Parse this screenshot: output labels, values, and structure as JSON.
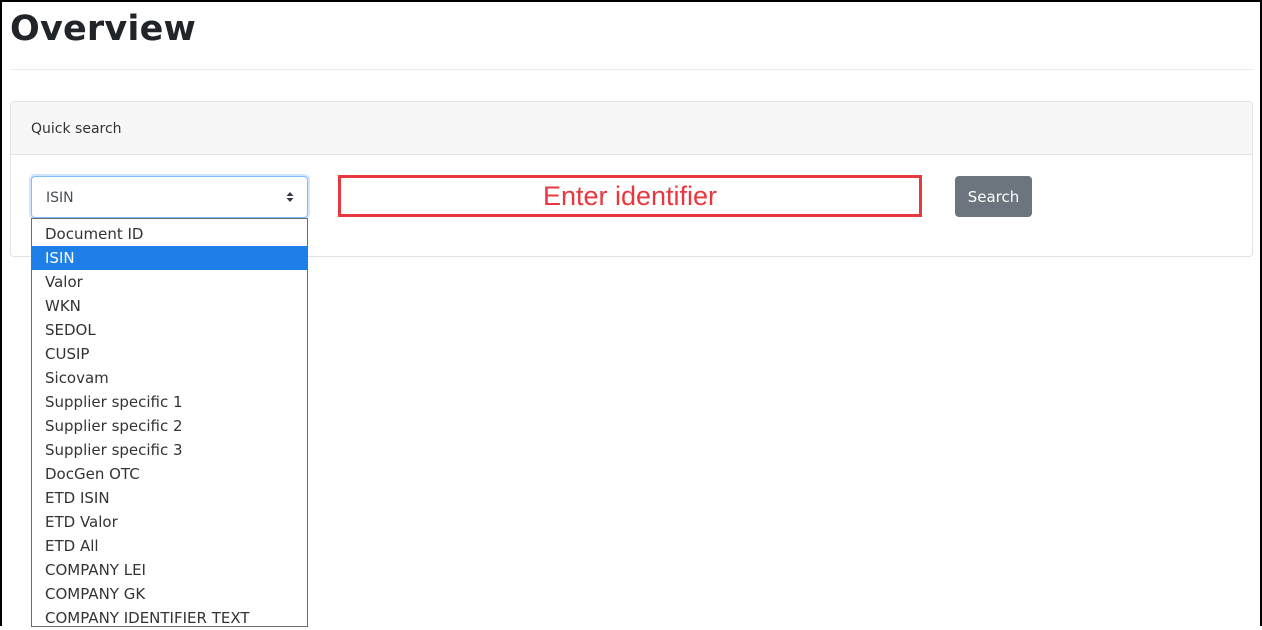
{
  "page": {
    "title": "Overview"
  },
  "quick_search": {
    "header": "Quick search",
    "select": {
      "selected": "ISIN",
      "options": [
        "Document ID",
        "ISIN",
        "Valor",
        "WKN",
        "SEDOL",
        "CUSIP",
        "Sicovam",
        "Supplier specific 1",
        "Supplier specific 2",
        "Supplier specific 3",
        "DocGen OTC",
        "ETD ISIN",
        "ETD Valor",
        "ETD All",
        "COMPANY LEI",
        "COMPANY GK",
        "COMPANY IDENTIFIER TEXT"
      ]
    },
    "input": {
      "placeholder": "Enter identifier",
      "value": ""
    },
    "button_label": "Search"
  },
  "colors": {
    "highlight": "#1e7fe8",
    "input_border": "#e8373e",
    "button_bg": "#6c757d"
  },
  "icons": {
    "select_arrows": "chevron-up-down-icon"
  }
}
